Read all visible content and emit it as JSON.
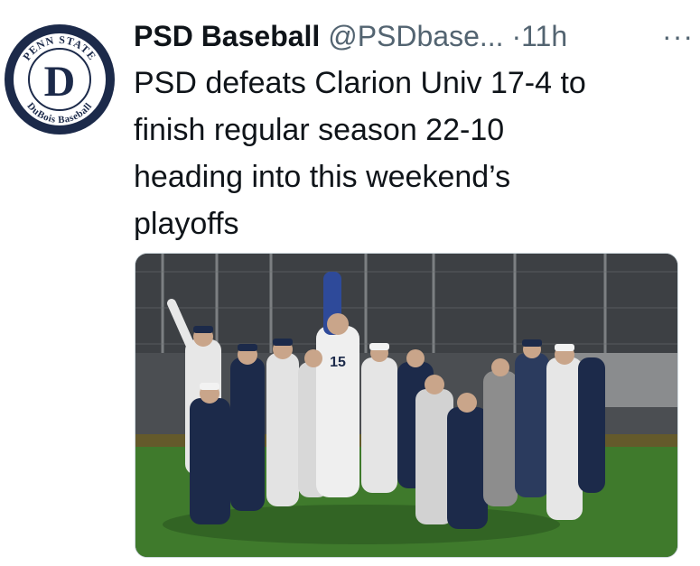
{
  "tweet": {
    "author_name": "PSD Baseball",
    "author_handle": "@PSDbase...",
    "separator": "·",
    "time": "11h",
    "more_label": "···",
    "text": "PSD defeats Clarion Univ 17-4 to\nfinish regular season 22-10\nheading into this weekend’s\nplayoffs"
  },
  "avatar": {
    "logo_top_text": "PENN STATE",
    "logo_bottom_text": "DuBois Baseball",
    "logo_letter": "D"
  },
  "media": {
    "jersey_number": "15"
  },
  "colors": {
    "navy": "#1c2a4a",
    "text": "#0f1419",
    "muted": "#536471",
    "grass": "#3f7a2c"
  }
}
